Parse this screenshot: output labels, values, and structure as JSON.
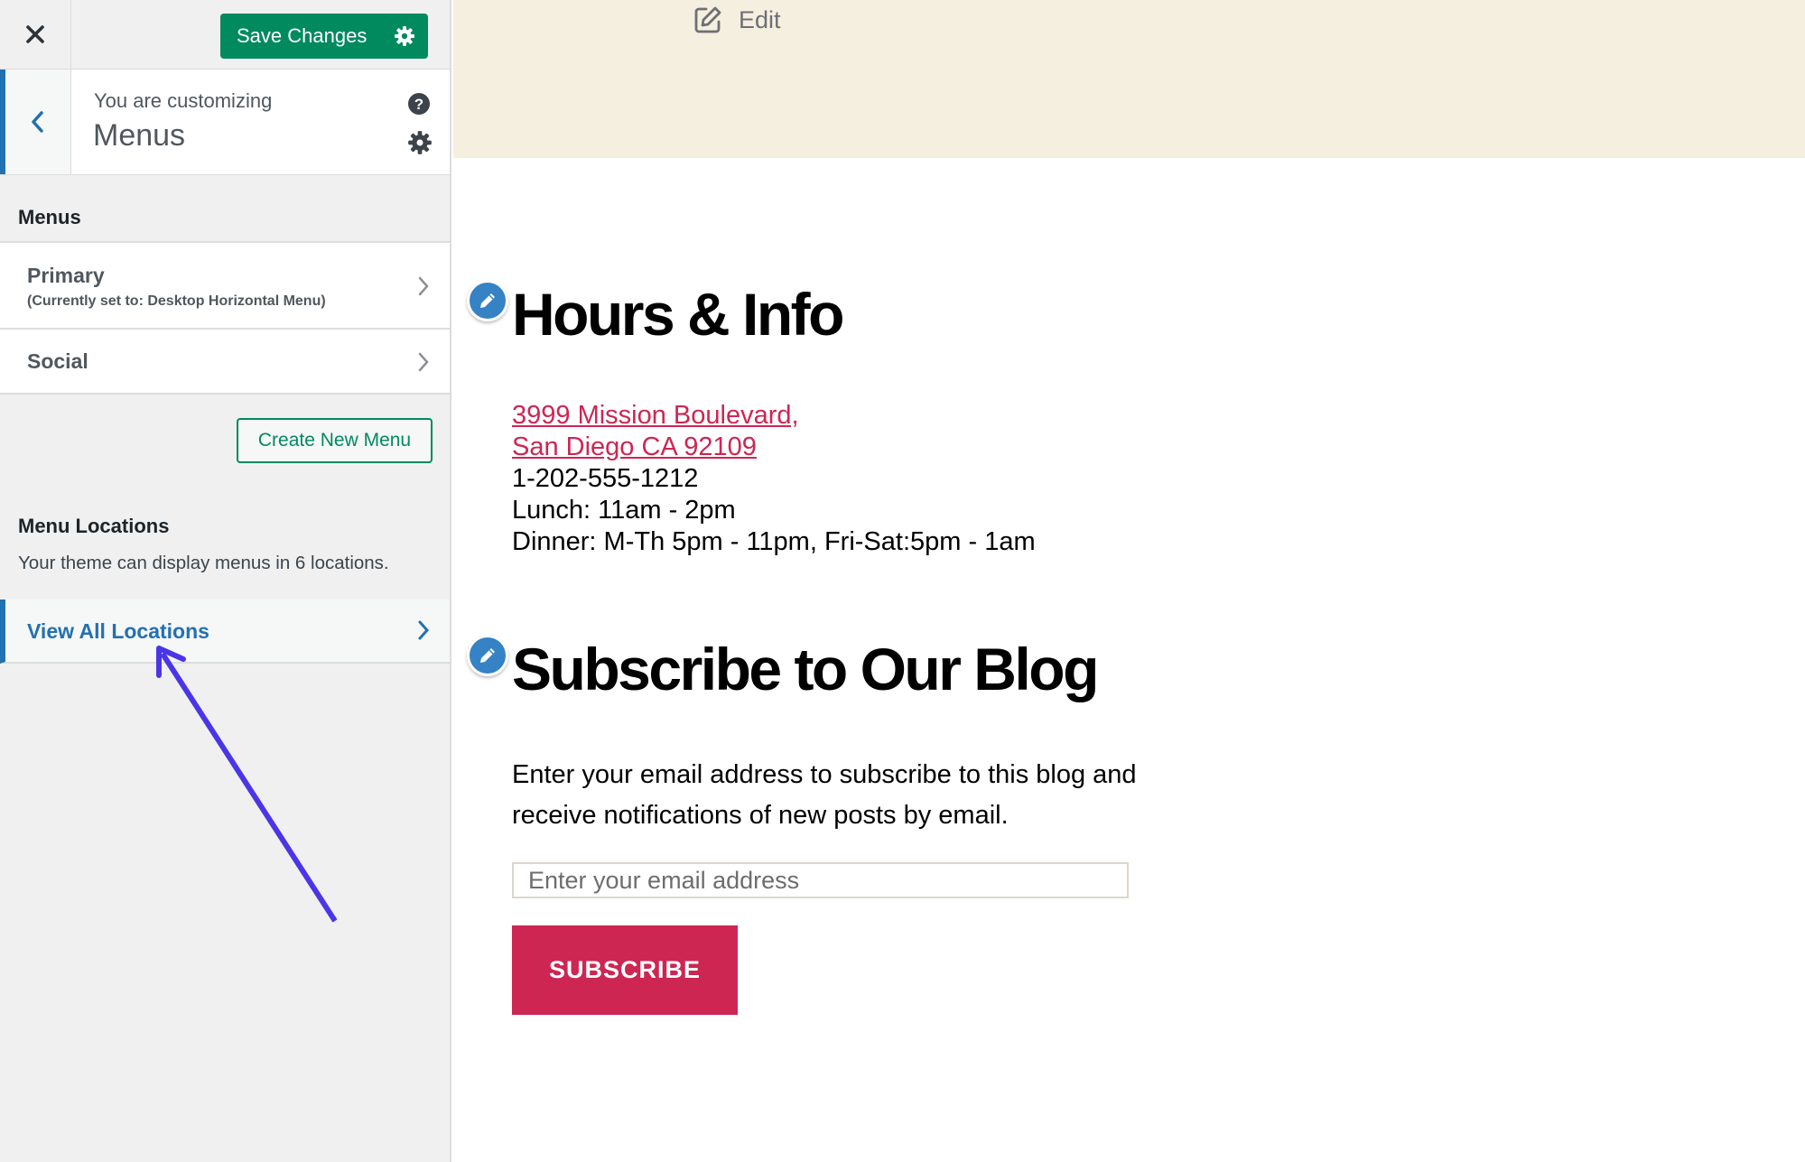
{
  "sidebar": {
    "close_icon": "close-icon",
    "save_button": {
      "label": "Save Changes",
      "icon": "gear-icon",
      "color": "#008a5e"
    },
    "header": {
      "customizing_label": "You are customizing",
      "title": "Menus",
      "back_icon": "chevron-left-icon",
      "help_icon": "help-icon",
      "settings_icon": "gear-icon"
    },
    "menus_section": {
      "title": "Menus",
      "items": [
        {
          "name": "Primary",
          "subtitle": "(Currently set to: Desktop Horizontal Menu)"
        },
        {
          "name": "Social",
          "subtitle": ""
        }
      ],
      "create_button": "Create New Menu"
    },
    "locations_section": {
      "title": "Menu Locations",
      "description": "Your theme can display menus in 6 locations.",
      "view_all": "View All Locations"
    },
    "accent_color": "#2271b1"
  },
  "annotation": {
    "type": "arrow",
    "color": "#4a36e6",
    "points_to": "View All Locations"
  },
  "preview": {
    "header_bg": "#f5efe0",
    "edit_link": "Edit",
    "hours_widget": {
      "title": "Hours & Info",
      "address_line1": "3999 Mission Boulevard,",
      "address_line2": "San Diego CA 92109",
      "phone": "1-202-555-1212",
      "lunch": "Lunch: 11am - 2pm",
      "dinner": "Dinner: M-Th 5pm - 11pm, Fri-Sat:5pm - 1am"
    },
    "subscribe_widget": {
      "title": "Subscribe to Our Blog",
      "description": "Enter your email address to subscribe to this blog and receive notifications of new posts by email.",
      "email_placeholder": "Enter your email address",
      "email_value": "",
      "button": "SUBSCRIBE",
      "button_color": "#cd2653"
    },
    "link_color": "#cd2653"
  }
}
